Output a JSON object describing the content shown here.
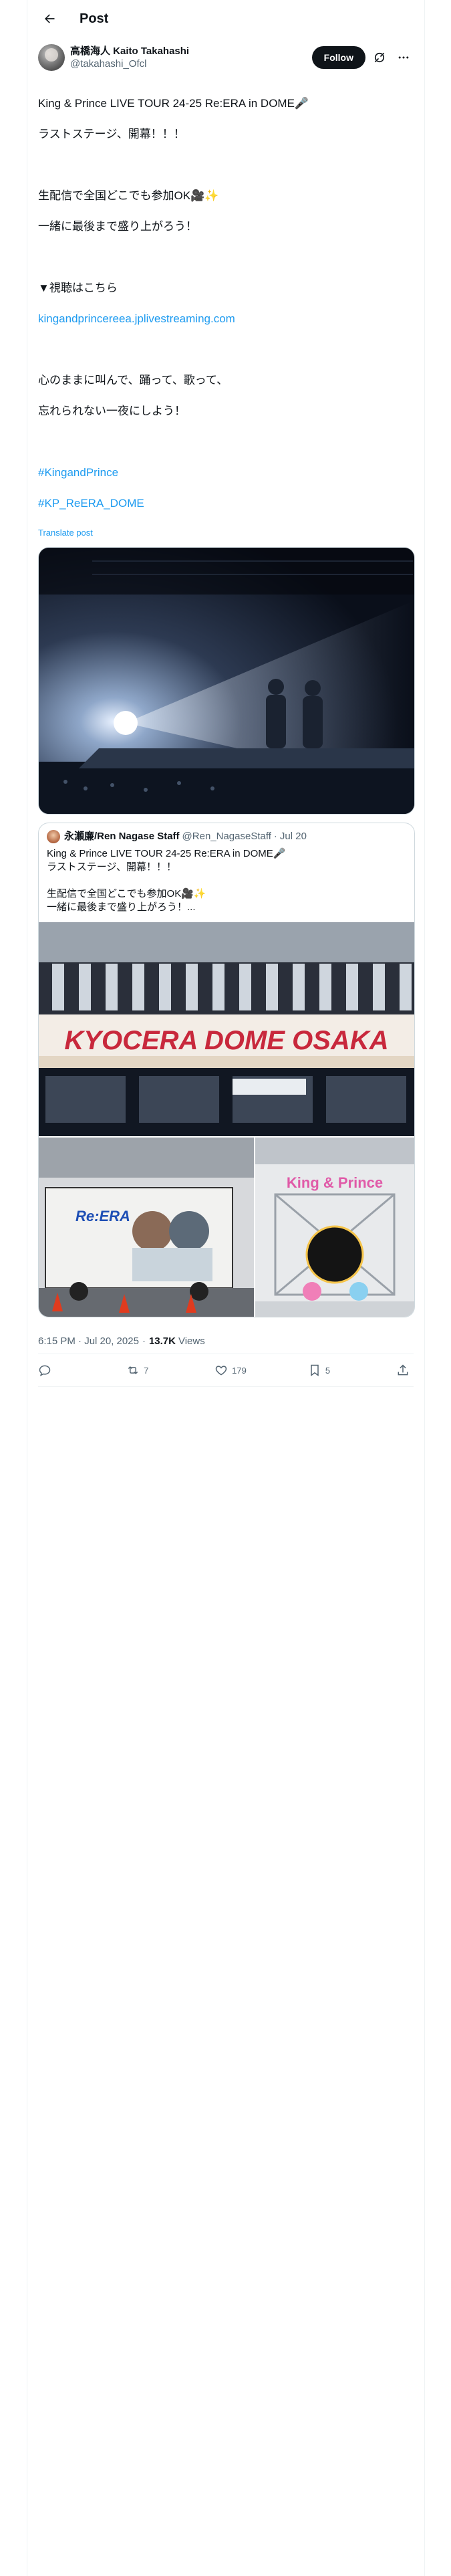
{
  "header": {
    "title": "Post"
  },
  "author": {
    "display_name": "高橋海人 Kaito Takahashi",
    "handle": "@takahashi_Ofcl",
    "follow_label": "Follow"
  },
  "post": {
    "lines": [
      "King & Prince LIVE TOUR 24-25 Re:ERA in DOME🎤",
      "ラストステージ、開幕！！！",
      "",
      "生配信で全国どこでも参加OK🎥✨",
      "一緒に最後まで盛り上がろう！",
      "",
      "▼視聴はこちら"
    ],
    "link": "kingandprincereea.jplivestreaming.com",
    "lines2": [
      "",
      "心のままに叫んで、踊って、歌って、",
      "忘れられない一夜にしよう！",
      ""
    ],
    "hashtags": [
      "#KingandPrince",
      "#KP_ReERA_DOME"
    ],
    "translate_label": "Translate post"
  },
  "quote": {
    "display_name": "永瀬廉/Ren Nagase Staff",
    "handle": "@Ren_NagaseStaff",
    "separator": "·",
    "date": "Jul 20",
    "lines": [
      "King & Prince LIVE TOUR 24-25 Re:ERA in DOME🎤",
      "ラストステージ、開幕！！！",
      "",
      "生配信で全国どこでも参加OK🎥✨",
      "一緒に最後まで盛り上がろう！..."
    ],
    "image_text": {
      "dome_sign": "KYOCERA DOME OSAKA",
      "truck_logo": "Re:ERA",
      "stage_logo": "King & Prince"
    }
  },
  "meta": {
    "time": "6:15 PM · Jul 20, 2025",
    "separator": "·",
    "views_count": "13.7K",
    "views_label": "Views"
  },
  "actions": {
    "reply": "",
    "repost": "7",
    "like": "179",
    "bookmark": "5"
  },
  "colors": {
    "accent": "#1d9bf0",
    "text": "#0f1419",
    "secondary": "#536471",
    "border": "#eff3f4"
  },
  "icons": [
    "back-arrow-icon",
    "grok-icon",
    "more-icon",
    "reply-icon",
    "repost-icon",
    "like-icon",
    "bookmark-icon",
    "share-icon"
  ]
}
